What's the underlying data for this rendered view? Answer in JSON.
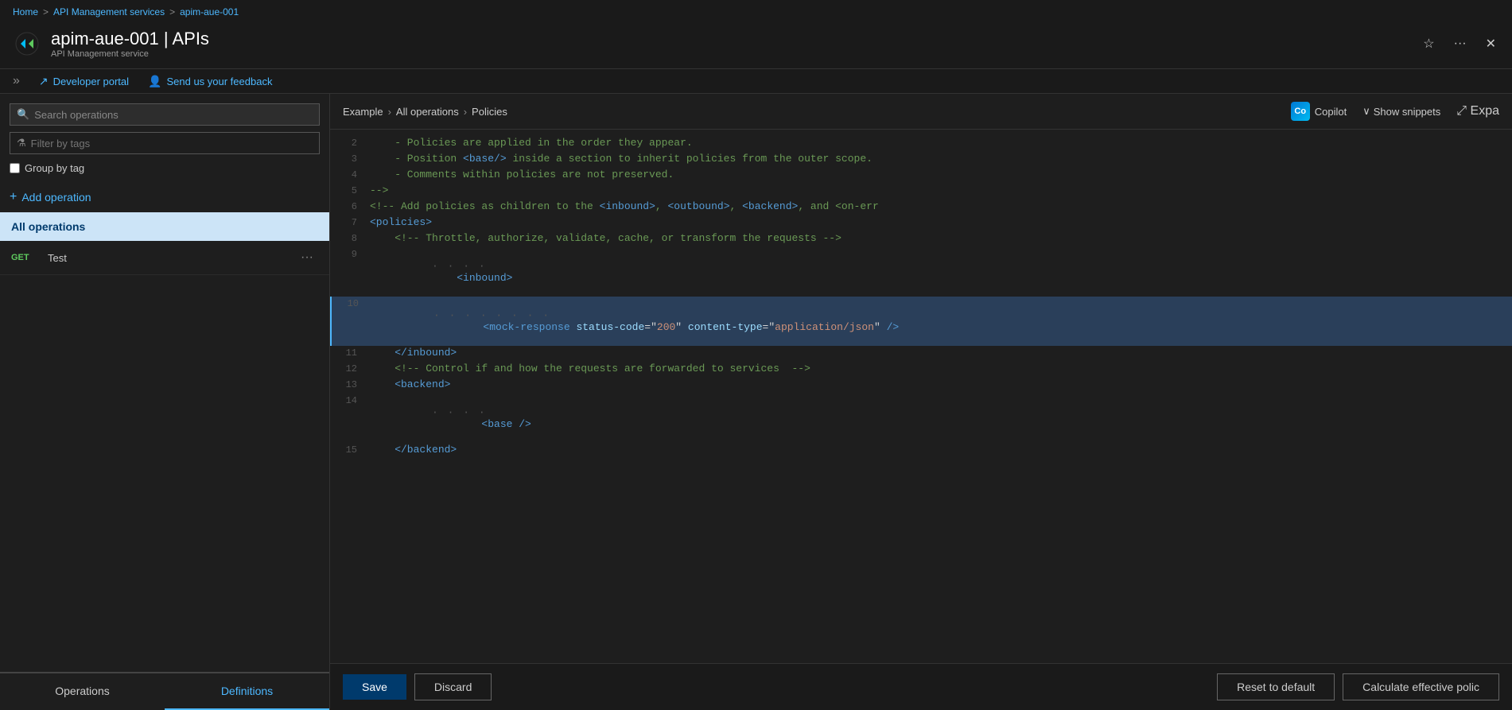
{
  "breadcrumb": {
    "home": "Home",
    "service": "API Management services",
    "instance": "apim-aue-001",
    "sep": ">"
  },
  "header": {
    "title": "apim-aue-001 | APIs",
    "subtitle": "API Management service",
    "star_label": "☆",
    "more_label": "···",
    "close_label": "✕"
  },
  "toolbar": {
    "developer_portal": "Developer portal",
    "feedback": "Send us your feedback"
  },
  "sidebar": {
    "search_placeholder": "Search operations",
    "filter_placeholder": "Filter by tags",
    "group_by_tag": "Group by tag",
    "add_operation": "Add operation",
    "all_operations": "All operations",
    "operations": [
      {
        "method": "GET",
        "name": "Test"
      }
    ],
    "tabs": [
      {
        "id": "operations",
        "label": "Operations",
        "active": false
      },
      {
        "id": "definitions",
        "label": "Definitions",
        "active": true
      }
    ]
  },
  "code_panel": {
    "breadcrumb": {
      "part1": "Example",
      "sep1": ">",
      "part2": "All operations",
      "sep2": ">",
      "part3": "Policies"
    },
    "copilot_label": "Copilot",
    "show_snippets_label": "Show snippets",
    "expand_label": "Expa",
    "lines": [
      {
        "num": "2",
        "content": "    - Policies are applied in the order they appear.",
        "type": "comment",
        "highlighted": false,
        "has_dots": false
      },
      {
        "num": "3",
        "content": "    - Position <base/> inside a section to inherit policies from the outer scope.",
        "type": "comment",
        "highlighted": false,
        "has_dots": false
      },
      {
        "num": "4",
        "content": "    - Comments within policies are not preserved.",
        "type": "comment",
        "highlighted": false,
        "has_dots": false
      },
      {
        "num": "5",
        "content": "-->",
        "type": "comment",
        "highlighted": false,
        "has_dots": false
      },
      {
        "num": "6",
        "content": "<!-- Add policies as children to the <inbound>, <outbound>, <backend>, and <on-err",
        "type": "comment",
        "highlighted": false,
        "has_dots": false
      },
      {
        "num": "7",
        "content": "<policies>",
        "type": "tag",
        "highlighted": false,
        "has_dots": false
      },
      {
        "num": "8",
        "content": "    <!-- Throttle, authorize, validate, cache, or transform the requests -->",
        "type": "comment",
        "highlighted": false,
        "has_dots": false
      },
      {
        "num": "9",
        "content": "    <inbound>",
        "type": "tag",
        "highlighted": false,
        "has_dots": true
      },
      {
        "num": "10",
        "content": "        <mock-response status-code=\"200\" content-type=\"application/json\" />",
        "type": "tag_special",
        "highlighted": true,
        "has_dots": true
      },
      {
        "num": "11",
        "content": "    </inbound>",
        "type": "tag",
        "highlighted": false,
        "has_dots": false
      },
      {
        "num": "12",
        "content": "    <!-- Control if and how the requests are forwarded to services  -->",
        "type": "comment",
        "highlighted": false,
        "has_dots": false
      },
      {
        "num": "13",
        "content": "    <backend>",
        "type": "tag",
        "highlighted": false,
        "has_dots": false
      },
      {
        "num": "14",
        "content": "        <base />",
        "type": "tag",
        "highlighted": false,
        "has_dots": true
      },
      {
        "num": "15",
        "content": "    </backend>",
        "type": "tag",
        "highlighted": false,
        "has_dots": false
      }
    ]
  },
  "bottom_bar": {
    "save": "Save",
    "discard": "Discard",
    "reset": "Reset to default",
    "calculate": "Calculate effective polic"
  },
  "icons": {
    "search": "🔍",
    "filter": "⚗",
    "add": "+",
    "chevron_down": "∨",
    "expand": "⤢",
    "star": "☆",
    "more": "···",
    "close": "✕",
    "external_link": "↗",
    "feedback_person": "👤",
    "copilot_text": "Co"
  }
}
